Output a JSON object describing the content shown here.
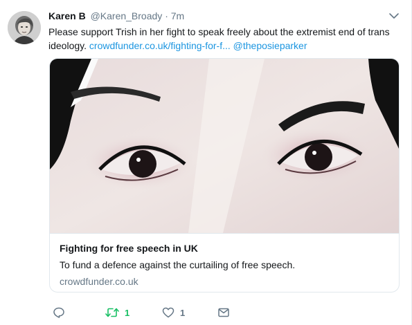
{
  "user": {
    "display_name": "Karen B",
    "handle": "@Karen_Broady",
    "separator": "·",
    "timestamp": "7m",
    "avatar_icon": "profile-photo"
  },
  "tweet": {
    "text_before": "Please support Trish in her fight to speak freely about the extremist end of trans ideology. ",
    "link_text": "crowdfunder.co.uk/fighting-for-f...",
    "mention": "@theposieparker"
  },
  "card": {
    "title": "Fighting for free speech in UK",
    "description": "To fund a defence against the curtailing of free speech.",
    "domain": "crowdfunder.co.uk",
    "image_icon": "close-up-eyes-photo"
  },
  "actions": {
    "reply_icon": "reply-icon",
    "retweet_icon": "retweet-icon",
    "retweet_count": "1",
    "like_icon": "heart-icon",
    "like_count": "1",
    "dm_icon": "envelope-icon"
  },
  "colors": {
    "link": "#1b95e0",
    "muted": "#657786",
    "retweet_active": "#17bf63",
    "border": "#e1e8ed",
    "text": "#14171a"
  }
}
